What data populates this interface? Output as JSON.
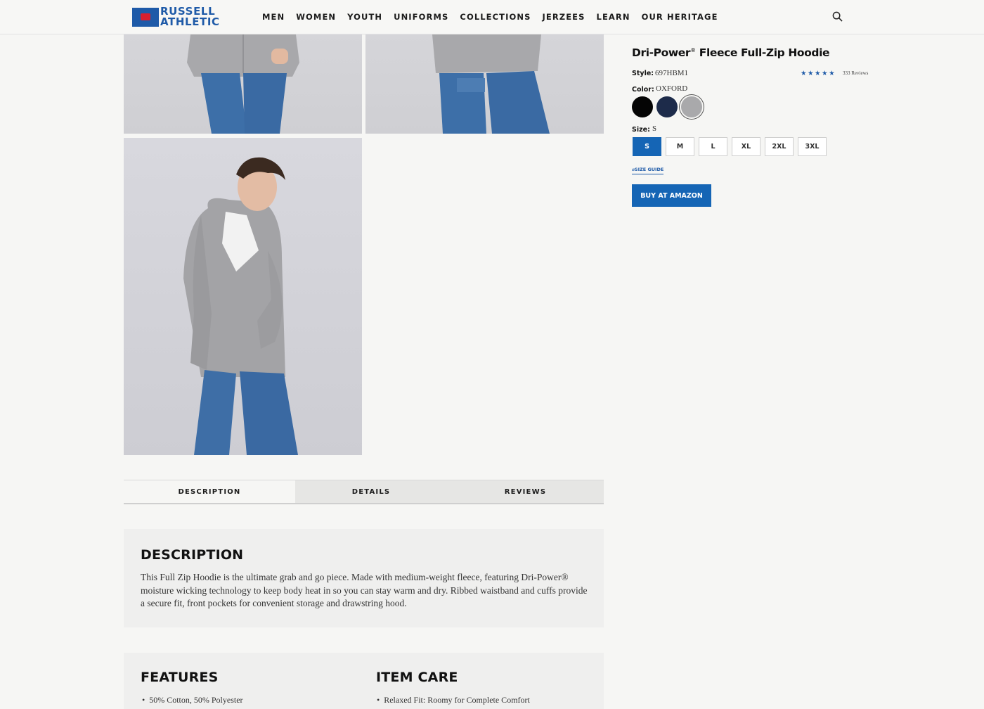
{
  "brand": {
    "line1": "RUSSELL",
    "line2": "ATHLETIC"
  },
  "nav": [
    "MEN",
    "WOMEN",
    "YOUTH",
    "UNIFORMS",
    "COLLECTIONS",
    "JERZEES",
    "LEARN",
    "OUR HERITAGE"
  ],
  "icons": {
    "search": "search-icon"
  },
  "product": {
    "title": "Dri-Power",
    "title_mark": "®",
    "title_rest": " Fleece Full-Zip Hoodie",
    "style_label": "Style:",
    "style_value": "697HBM1",
    "rating_stars": "★★★★★",
    "rating_value": 4.5,
    "reviews": "333 Reviews",
    "color_label": "Color:",
    "color_value": "OXFORD",
    "colors": [
      {
        "name": "black",
        "hex": "#050505"
      },
      {
        "name": "navy",
        "hex": "#1d2b4a"
      },
      {
        "name": "oxford",
        "hex": "#a9a9ab",
        "selected": true
      }
    ],
    "size_label": "Size:",
    "size_value": "S",
    "sizes": [
      "S",
      "M",
      "L",
      "XL",
      "2XL",
      "3XL"
    ],
    "size_guide": "SIZE GUIDE",
    "buy_button": "BUY AT AMAZON"
  },
  "tabs": [
    "DESCRIPTION",
    "DETAILS",
    "REVIEWS"
  ],
  "description": {
    "heading": "DESCRIPTION",
    "text": "This Full Zip Hoodie is the ultimate grab and go piece. Made with medium-weight fleece, featuring Dri-Power® moisture wicking technology to keep body heat in so you can stay warm and dry. Ribbed waistband and cuffs provide a secure fit, front pockets for convenient storage and drawstring hood."
  },
  "features": {
    "heading": "FEATURES",
    "items": [
      "50% Cotton, 50% Polyester"
    ]
  },
  "item_care": {
    "heading": "ITEM CARE",
    "items": [
      "Relaxed Fit: Roomy for Complete Comfort"
    ]
  },
  "colors": {
    "accent": "#1565b5",
    "brand_blue": "#1e5aa8",
    "brand_red": "#d71f2f"
  }
}
